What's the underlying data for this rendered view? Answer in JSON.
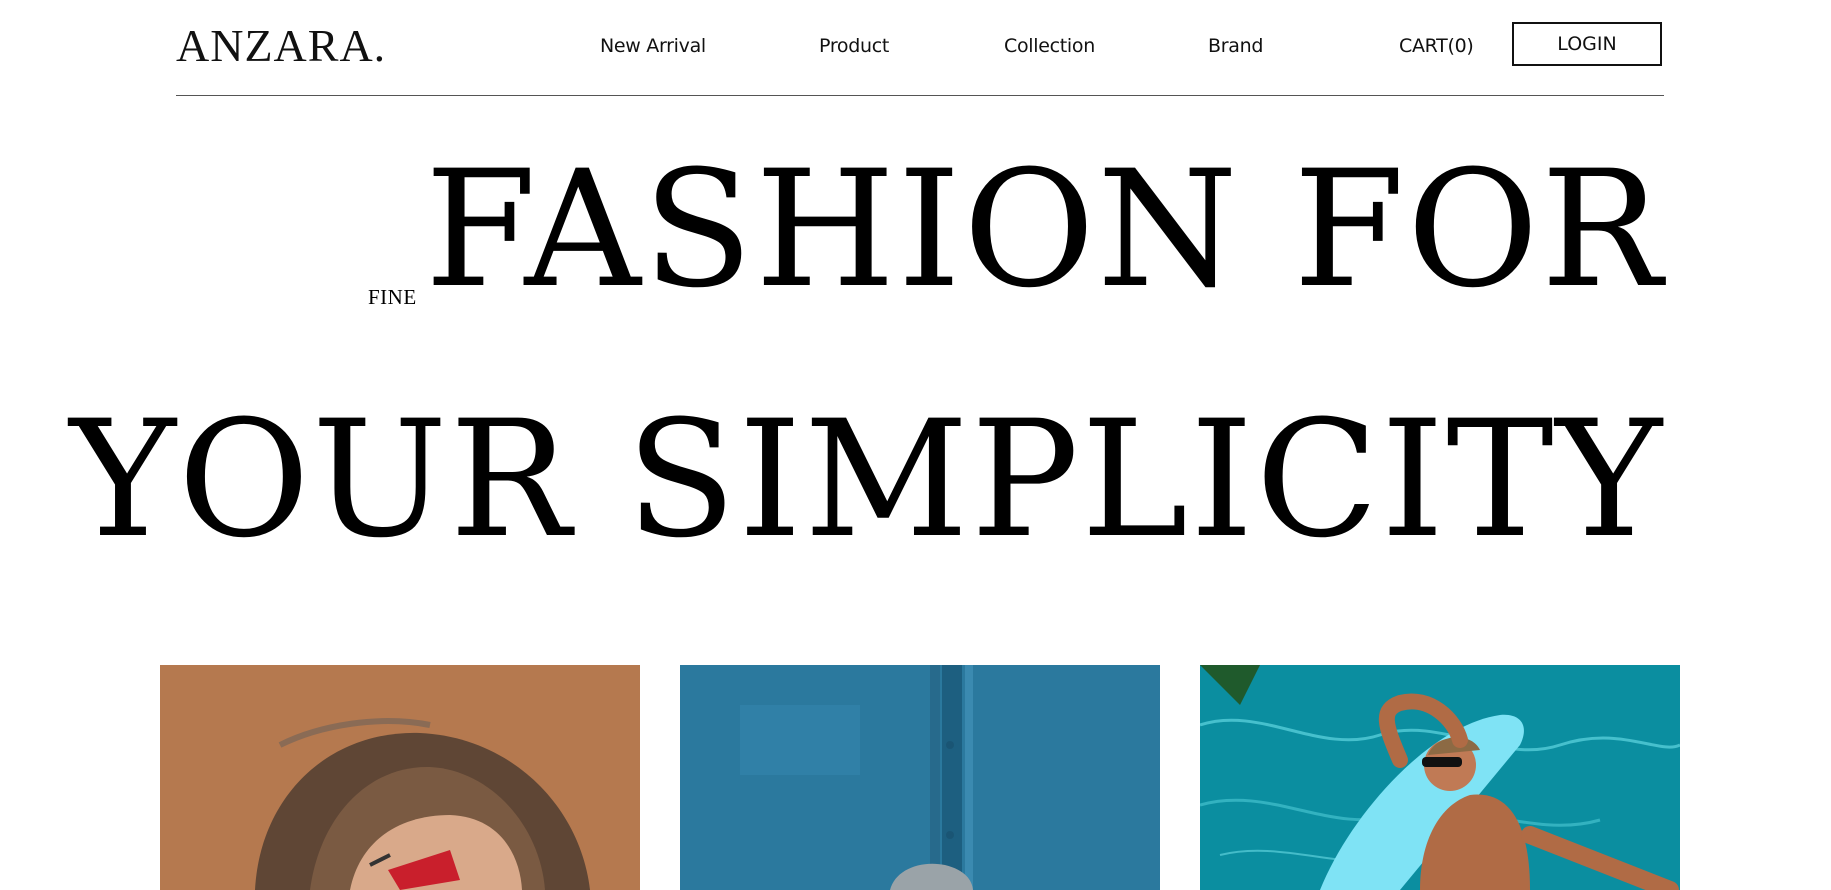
{
  "header": {
    "logo": "ANZARA.",
    "nav": [
      "New Arrival",
      "Product",
      "Collection",
      "Brand"
    ],
    "cart_label": "CART(0)",
    "login_label": "LOGIN"
  },
  "hero": {
    "eyebrow": "FINE",
    "line1": "FASHION FOR",
    "line2": "YOUR SIMPLICITY"
  },
  "gallery": {
    "images": [
      {
        "name": "woman-red-sunglasses-photo",
        "bg": "#b5794f"
      },
      {
        "name": "blue-wall-photo",
        "bg": "#2f7ea3"
      },
      {
        "name": "man-pool-float-photo",
        "bg": "#0b8ea0"
      }
    ]
  }
}
